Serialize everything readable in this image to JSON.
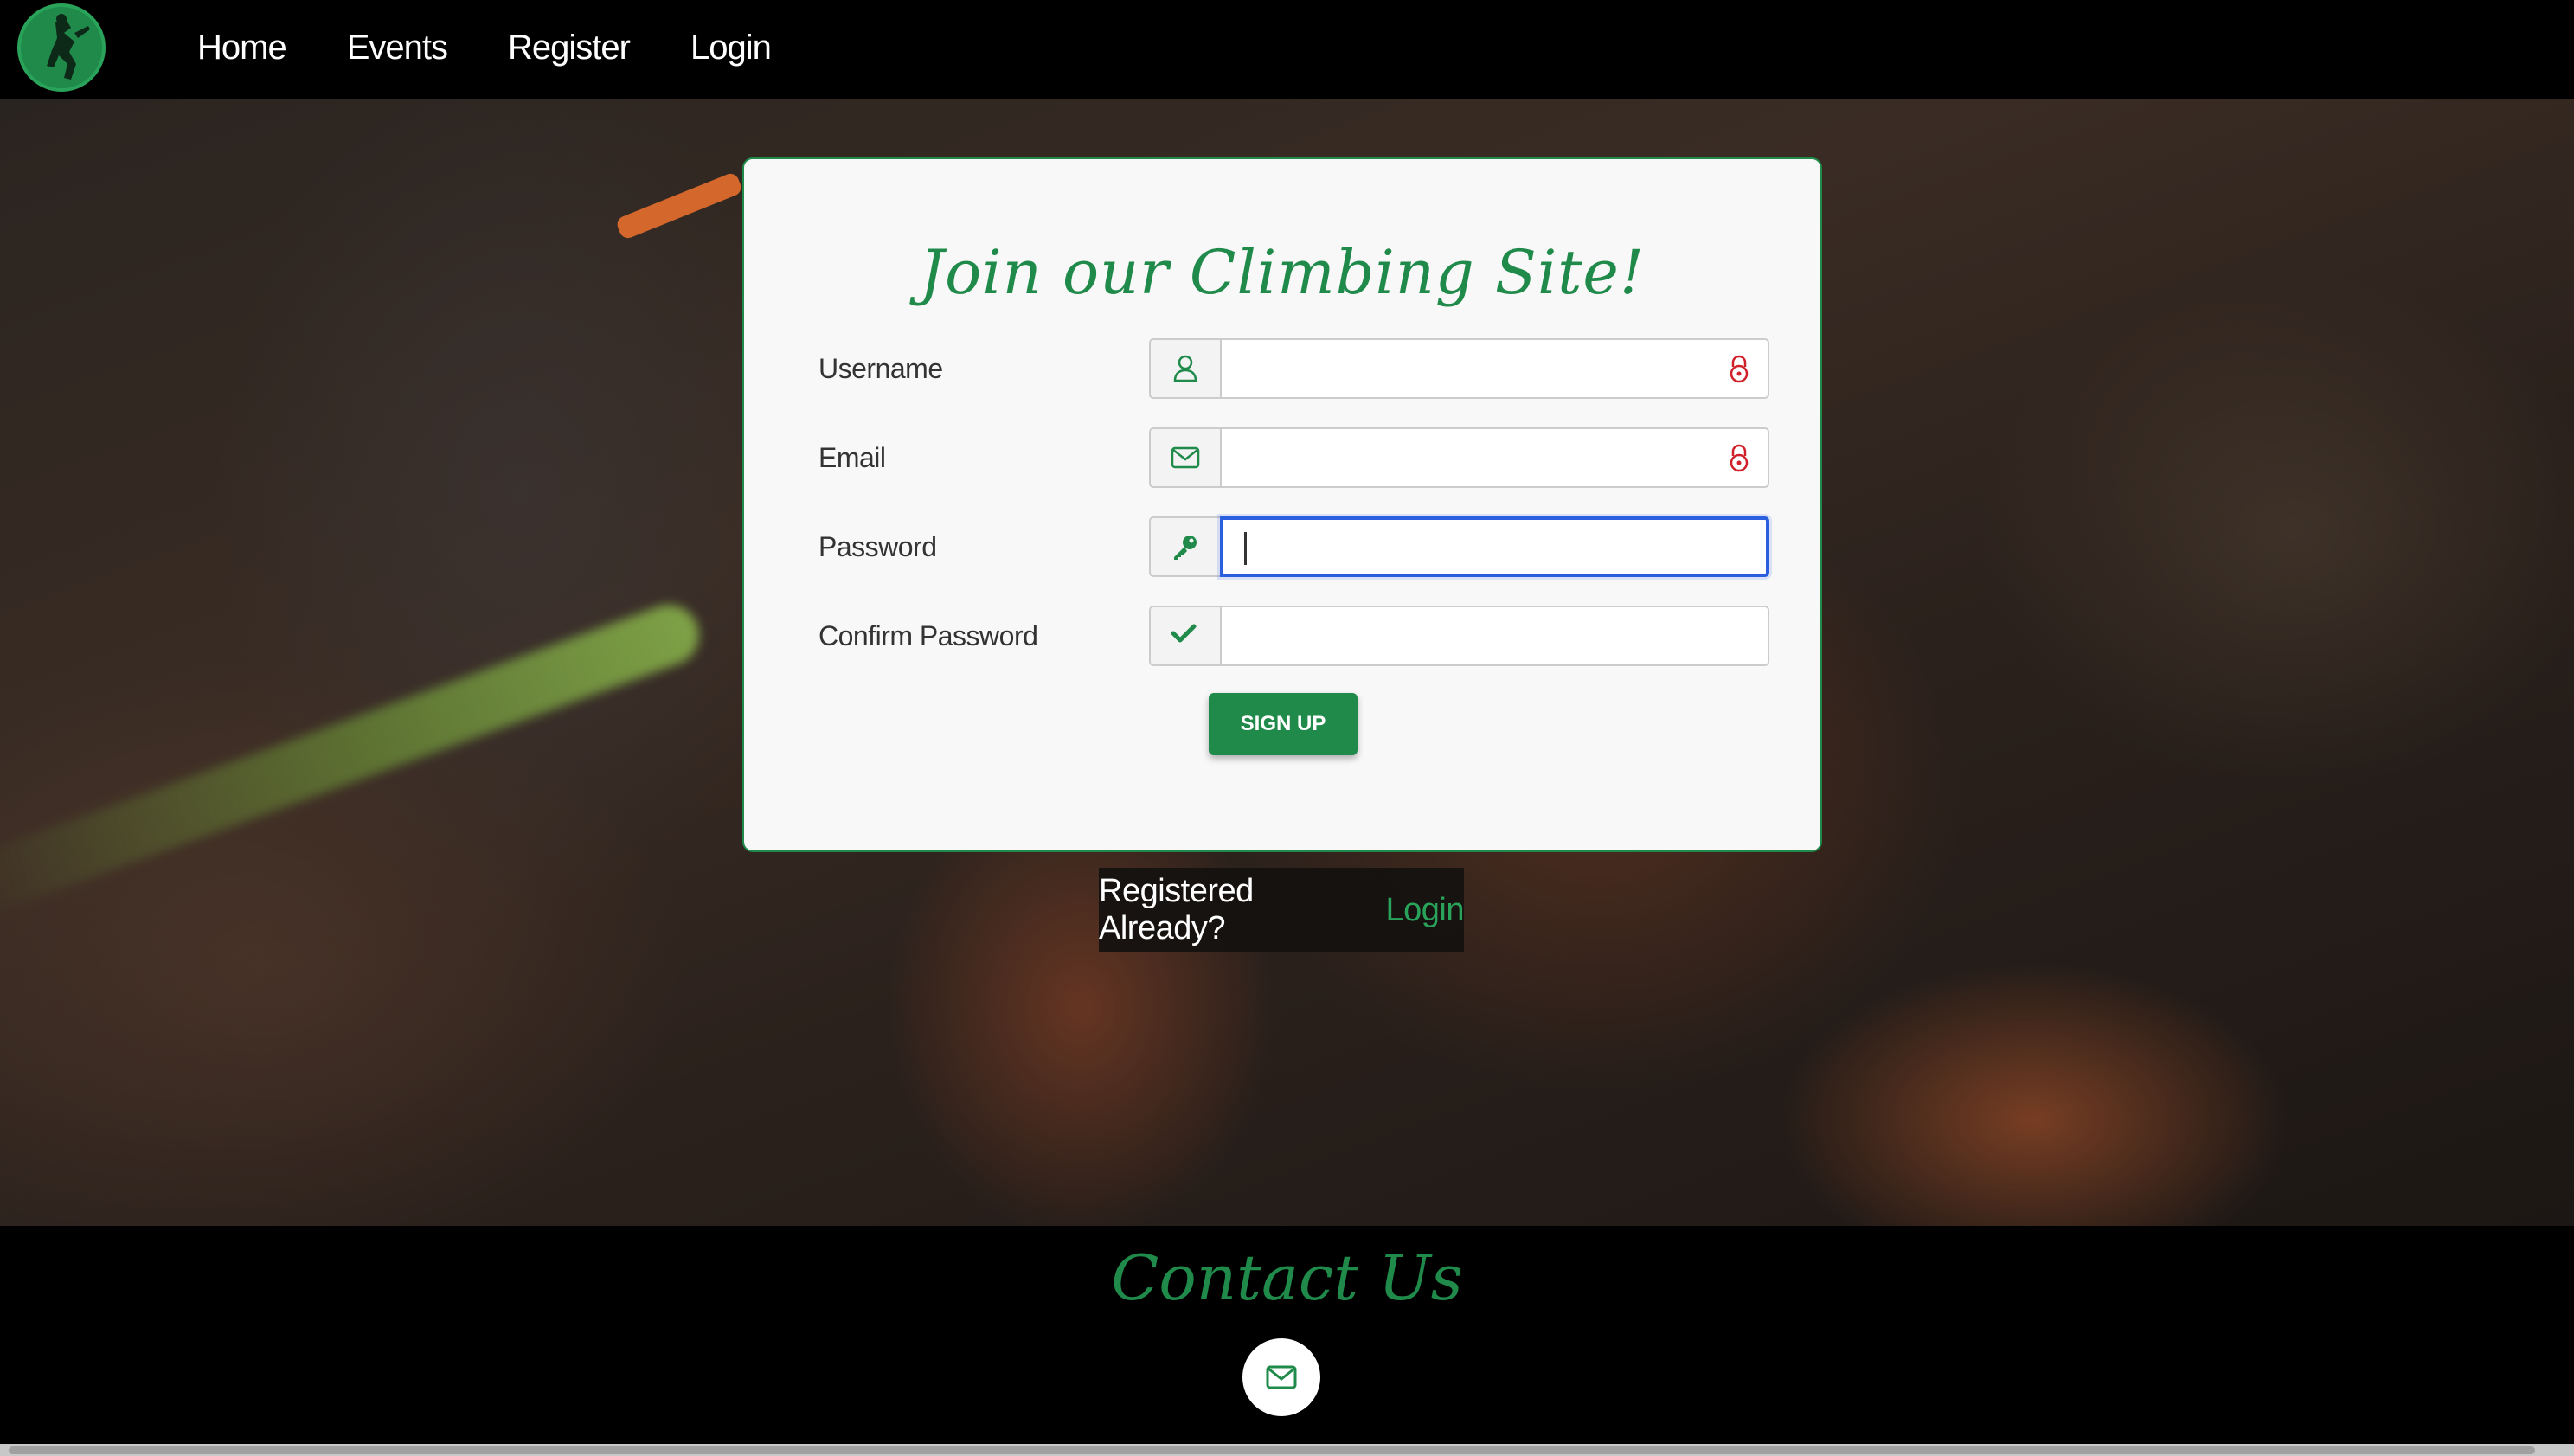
{
  "nav": {
    "logo_alt": "climber logo",
    "links": [
      "Home",
      "Events",
      "Register",
      "Login"
    ]
  },
  "form": {
    "title": "Join our Climbing Site!",
    "fields": [
      {
        "label": "Username",
        "value": "",
        "icon": "user-icon"
      },
      {
        "label": "Email",
        "value": "",
        "icon": "envelope-icon"
      },
      {
        "label": "Password",
        "value": "",
        "icon": "key-icon",
        "focused": true
      },
      {
        "label": "Confirm Password",
        "value": "",
        "icon": "check-icon"
      }
    ],
    "submit_label": "SIGN UP"
  },
  "registered": {
    "text": "Registered Already?",
    "link": "Login"
  },
  "footer": {
    "contact_title": "Contact Us",
    "contact_icon": "envelope-icon"
  },
  "colors": {
    "accent": "#1f8a4a",
    "focus": "#2c5fe0",
    "lock": "#d0202a"
  }
}
